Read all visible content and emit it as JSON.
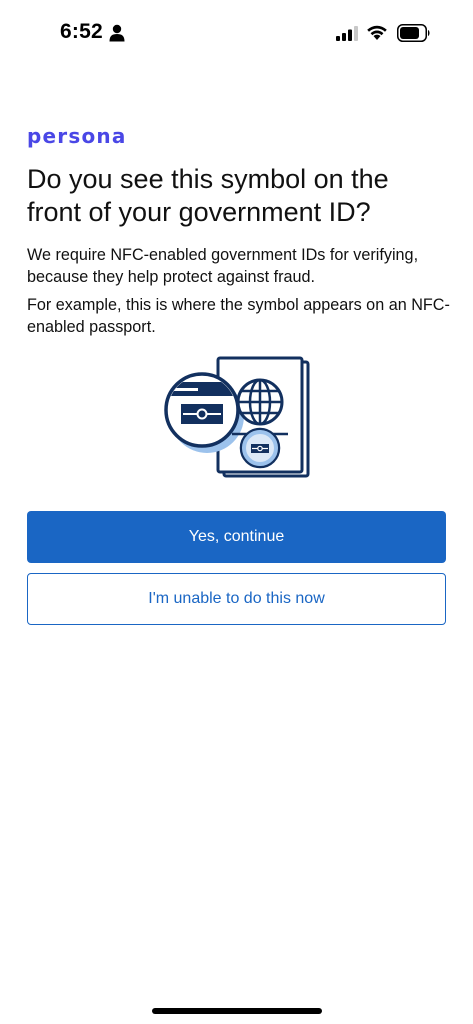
{
  "status_bar": {
    "time": "6:52"
  },
  "brand": {
    "name": "persona",
    "color": "#4a47e6"
  },
  "content": {
    "title": "Do you see this symbol on the front of your government ID?",
    "description": "We require NFC-enabled government IDs for verifying, because they help protect against fraud.",
    "example": "For example, this is where the symbol appears on an NFC-enabled passport."
  },
  "buttons": {
    "primary_label": "Yes, continue",
    "secondary_label": "I'm unable to do this now"
  },
  "colors": {
    "accent": "#1a66c4",
    "illustration_dark": "#12305f",
    "illustration_light": "#9cc2ec"
  }
}
